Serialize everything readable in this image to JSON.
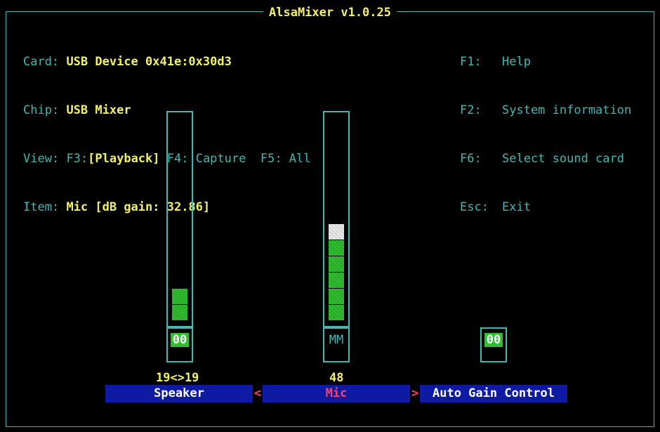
{
  "title": "AlsaMixer v1.0.25",
  "header": {
    "card_label": "Card:",
    "card_value": "USB Device 0x41e:0x30d3",
    "chip_label": "Chip:",
    "chip_value": "USB Mixer",
    "view_label": "View:",
    "view_f3_key": "F3:",
    "view_f3_value": "[Playback]",
    "view_f4": "F4: Capture",
    "view_f5": "F5: All",
    "item_label": "Item:",
    "item_value": "Mic [dB gain: 32.86]"
  },
  "menu": [
    {
      "key": "F1:",
      "label": "Help"
    },
    {
      "key": "F2:",
      "label": "System information"
    },
    {
      "key": "F6:",
      "label": "Select sound card"
    },
    {
      "key": "Esc:",
      "label": "Exit"
    }
  ],
  "channels": [
    {
      "name": "Speaker",
      "level_text": "19<>19",
      "level_fraction": 0.19,
      "mute_text": "00",
      "selected": false
    },
    {
      "name": "Mic",
      "level_text": "48",
      "level_fraction": 0.48,
      "mute_text": "MM",
      "selected": true
    },
    {
      "name": "Auto Gain Control",
      "level_text": "",
      "mute_text": "00",
      "selected": false
    }
  ],
  "selection_arrows": {
    "left": "<",
    "right": ">"
  },
  "colors": {
    "frame": "#3fb9b4",
    "highlight": "#f3f06a",
    "bar_green": "#2fbf2f",
    "bar_white": "#e8e8e8",
    "name_bg": "#0e1aa1",
    "selected_text": "#ff3f6c"
  }
}
